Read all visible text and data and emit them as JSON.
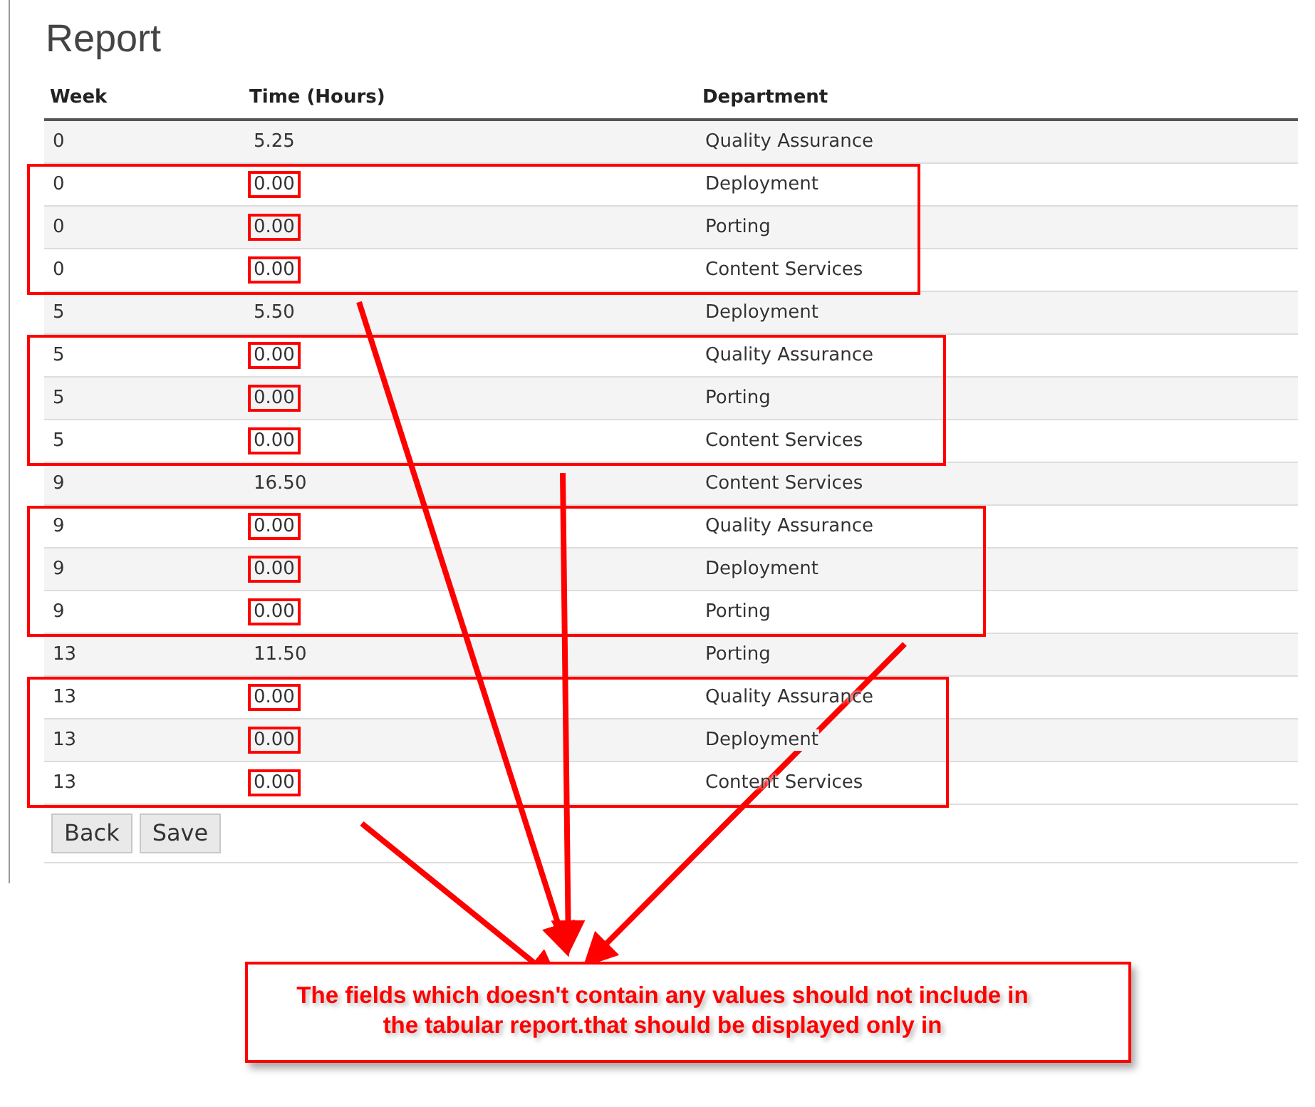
{
  "title": "Report",
  "table": {
    "columns": [
      "Week",
      "Time (Hours)",
      "Department"
    ],
    "rows": [
      {
        "week": "0",
        "time": "5.25",
        "department": "Quality Assurance",
        "highlighted": false
      },
      {
        "week": "0",
        "time": "0.00",
        "department": "Deployment",
        "highlighted": true
      },
      {
        "week": "0",
        "time": "0.00",
        "department": "Porting",
        "highlighted": true
      },
      {
        "week": "0",
        "time": "0.00",
        "department": "Content Services",
        "highlighted": true
      },
      {
        "week": "5",
        "time": "5.50",
        "department": "Deployment",
        "highlighted": false
      },
      {
        "week": "5",
        "time": "0.00",
        "department": "Quality Assurance",
        "highlighted": true
      },
      {
        "week": "5",
        "time": "0.00",
        "department": "Porting",
        "highlighted": true
      },
      {
        "week": "5",
        "time": "0.00",
        "department": "Content Services",
        "highlighted": true
      },
      {
        "week": "9",
        "time": "16.50",
        "department": "Content Services",
        "highlighted": false
      },
      {
        "week": "9",
        "time": "0.00",
        "department": "Quality Assurance",
        "highlighted": true
      },
      {
        "week": "9",
        "time": "0.00",
        "department": "Deployment",
        "highlighted": true
      },
      {
        "week": "9",
        "time": "0.00",
        "department": "Porting",
        "highlighted": true
      },
      {
        "week": "13",
        "time": "11.50",
        "department": "Porting",
        "highlighted": false
      },
      {
        "week": "13",
        "time": "0.00",
        "department": "Quality Assurance",
        "highlighted": true
      },
      {
        "week": "13",
        "time": "0.00",
        "department": "Deployment",
        "highlighted": true
      },
      {
        "week": "13",
        "time": "0.00",
        "department": "Content Services",
        "highlighted": true
      }
    ]
  },
  "buttons": [
    "Back",
    "Save"
  ],
  "callout": "The fields which doesn't contain any values should not include in the tabular report.that should be displayed only in"
}
